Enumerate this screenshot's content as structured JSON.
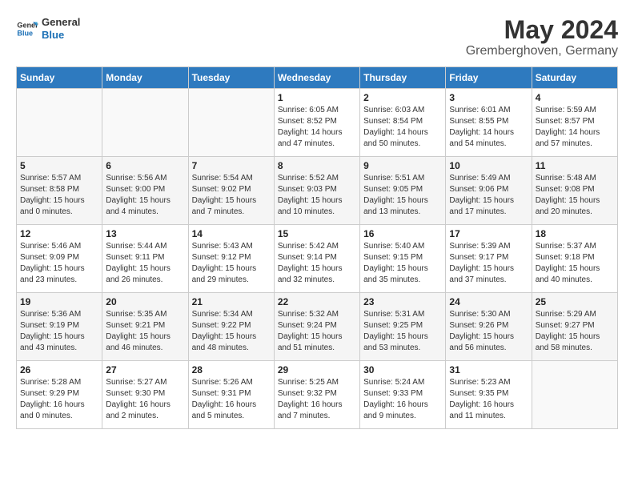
{
  "header": {
    "logo_line1": "General",
    "logo_line2": "Blue",
    "month": "May 2024",
    "location": "Gremberghoven, Germany"
  },
  "columns": [
    "Sunday",
    "Monday",
    "Tuesday",
    "Wednesday",
    "Thursday",
    "Friday",
    "Saturday"
  ],
  "weeks": [
    [
      {
        "day": "",
        "info": ""
      },
      {
        "day": "",
        "info": ""
      },
      {
        "day": "",
        "info": ""
      },
      {
        "day": "1",
        "info": "Sunrise: 6:05 AM\nSunset: 8:52 PM\nDaylight: 14 hours and 47 minutes."
      },
      {
        "day": "2",
        "info": "Sunrise: 6:03 AM\nSunset: 8:54 PM\nDaylight: 14 hours and 50 minutes."
      },
      {
        "day": "3",
        "info": "Sunrise: 6:01 AM\nSunset: 8:55 PM\nDaylight: 14 hours and 54 minutes."
      },
      {
        "day": "4",
        "info": "Sunrise: 5:59 AM\nSunset: 8:57 PM\nDaylight: 14 hours and 57 minutes."
      }
    ],
    [
      {
        "day": "5",
        "info": "Sunrise: 5:57 AM\nSunset: 8:58 PM\nDaylight: 15 hours and 0 minutes."
      },
      {
        "day": "6",
        "info": "Sunrise: 5:56 AM\nSunset: 9:00 PM\nDaylight: 15 hours and 4 minutes."
      },
      {
        "day": "7",
        "info": "Sunrise: 5:54 AM\nSunset: 9:02 PM\nDaylight: 15 hours and 7 minutes."
      },
      {
        "day": "8",
        "info": "Sunrise: 5:52 AM\nSunset: 9:03 PM\nDaylight: 15 hours and 10 minutes."
      },
      {
        "day": "9",
        "info": "Sunrise: 5:51 AM\nSunset: 9:05 PM\nDaylight: 15 hours and 13 minutes."
      },
      {
        "day": "10",
        "info": "Sunrise: 5:49 AM\nSunset: 9:06 PM\nDaylight: 15 hours and 17 minutes."
      },
      {
        "day": "11",
        "info": "Sunrise: 5:48 AM\nSunset: 9:08 PM\nDaylight: 15 hours and 20 minutes."
      }
    ],
    [
      {
        "day": "12",
        "info": "Sunrise: 5:46 AM\nSunset: 9:09 PM\nDaylight: 15 hours and 23 minutes."
      },
      {
        "day": "13",
        "info": "Sunrise: 5:44 AM\nSunset: 9:11 PM\nDaylight: 15 hours and 26 minutes."
      },
      {
        "day": "14",
        "info": "Sunrise: 5:43 AM\nSunset: 9:12 PM\nDaylight: 15 hours and 29 minutes."
      },
      {
        "day": "15",
        "info": "Sunrise: 5:42 AM\nSunset: 9:14 PM\nDaylight: 15 hours and 32 minutes."
      },
      {
        "day": "16",
        "info": "Sunrise: 5:40 AM\nSunset: 9:15 PM\nDaylight: 15 hours and 35 minutes."
      },
      {
        "day": "17",
        "info": "Sunrise: 5:39 AM\nSunset: 9:17 PM\nDaylight: 15 hours and 37 minutes."
      },
      {
        "day": "18",
        "info": "Sunrise: 5:37 AM\nSunset: 9:18 PM\nDaylight: 15 hours and 40 minutes."
      }
    ],
    [
      {
        "day": "19",
        "info": "Sunrise: 5:36 AM\nSunset: 9:19 PM\nDaylight: 15 hours and 43 minutes."
      },
      {
        "day": "20",
        "info": "Sunrise: 5:35 AM\nSunset: 9:21 PM\nDaylight: 15 hours and 46 minutes."
      },
      {
        "day": "21",
        "info": "Sunrise: 5:34 AM\nSunset: 9:22 PM\nDaylight: 15 hours and 48 minutes."
      },
      {
        "day": "22",
        "info": "Sunrise: 5:32 AM\nSunset: 9:24 PM\nDaylight: 15 hours and 51 minutes."
      },
      {
        "day": "23",
        "info": "Sunrise: 5:31 AM\nSunset: 9:25 PM\nDaylight: 15 hours and 53 minutes."
      },
      {
        "day": "24",
        "info": "Sunrise: 5:30 AM\nSunset: 9:26 PM\nDaylight: 15 hours and 56 minutes."
      },
      {
        "day": "25",
        "info": "Sunrise: 5:29 AM\nSunset: 9:27 PM\nDaylight: 15 hours and 58 minutes."
      }
    ],
    [
      {
        "day": "26",
        "info": "Sunrise: 5:28 AM\nSunset: 9:29 PM\nDaylight: 16 hours and 0 minutes."
      },
      {
        "day": "27",
        "info": "Sunrise: 5:27 AM\nSunset: 9:30 PM\nDaylight: 16 hours and 2 minutes."
      },
      {
        "day": "28",
        "info": "Sunrise: 5:26 AM\nSunset: 9:31 PM\nDaylight: 16 hours and 5 minutes."
      },
      {
        "day": "29",
        "info": "Sunrise: 5:25 AM\nSunset: 9:32 PM\nDaylight: 16 hours and 7 minutes."
      },
      {
        "day": "30",
        "info": "Sunrise: 5:24 AM\nSunset: 9:33 PM\nDaylight: 16 hours and 9 minutes."
      },
      {
        "day": "31",
        "info": "Sunrise: 5:23 AM\nSunset: 9:35 PM\nDaylight: 16 hours and 11 minutes."
      },
      {
        "day": "",
        "info": ""
      }
    ]
  ]
}
